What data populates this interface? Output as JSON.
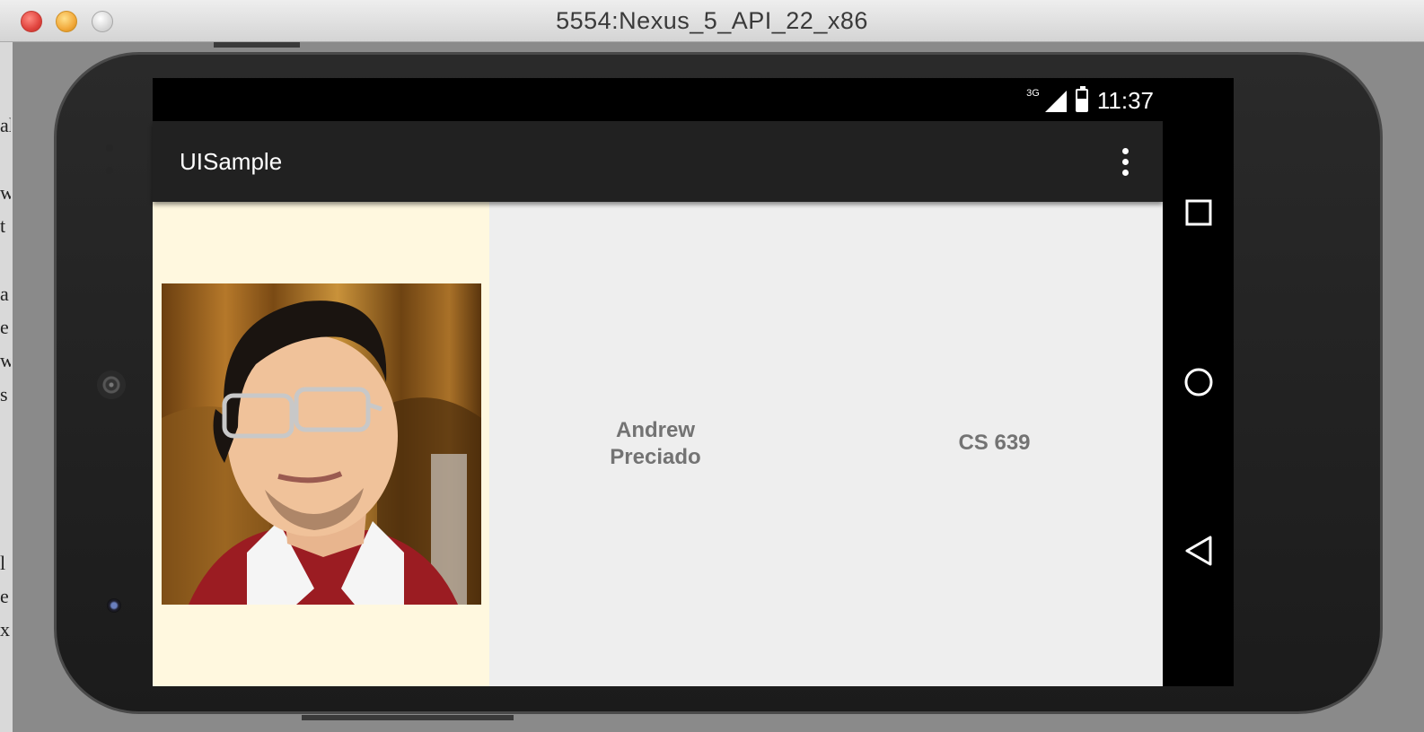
{
  "window": {
    "title": "5554:Nexus_5_API_22_x86"
  },
  "background_text": [
    "al",
    "w",
    "t",
    "a",
    "e",
    "w",
    "s",
    "l",
    "e",
    "x"
  ],
  "status_bar": {
    "network": "3G",
    "time": "11:37",
    "battery_level": 0.6
  },
  "app_bar": {
    "title": "UISample",
    "overflow_icon": "more-vert-icon"
  },
  "content": {
    "name": "Andrew\nPreciado",
    "course": "CS 639"
  },
  "nav_bar": {
    "recents_icon": "square-icon",
    "home_icon": "circle-icon",
    "back_icon": "triangle-back-icon"
  }
}
